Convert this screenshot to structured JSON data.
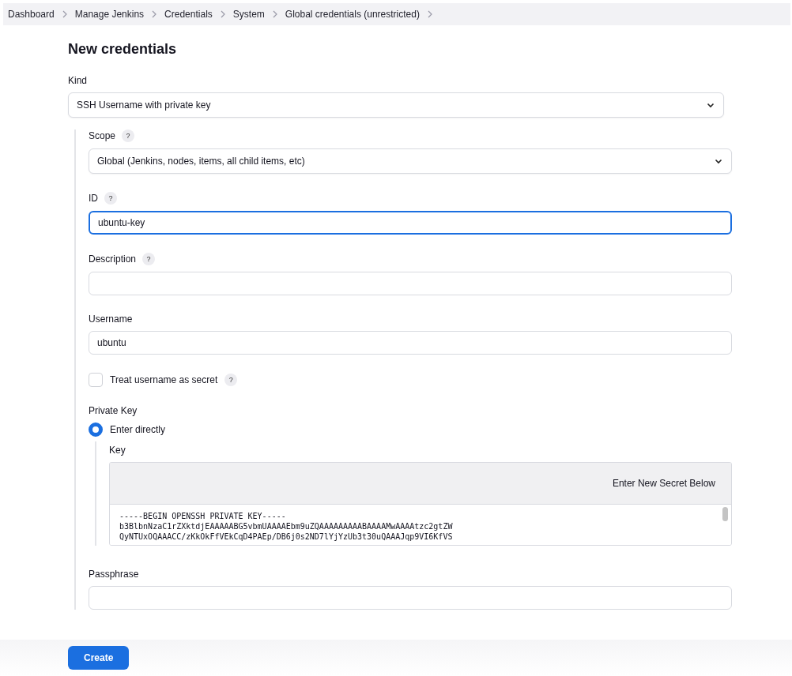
{
  "breadcrumbs": [
    "Dashboard",
    "Manage Jenkins",
    "Credentials",
    "System",
    "Global credentials (unrestricted)"
  ],
  "title": "New credentials",
  "kind": {
    "label": "Kind",
    "value": "SSH Username with private key"
  },
  "fields": [
    {
      "kind": "select",
      "label": "Scope",
      "help": "?",
      "value": "Global (Jenkins, nodes, items, all child items, etc)",
      "focused": false
    },
    {
      "kind": "text",
      "label": "ID",
      "help": "?",
      "value": "ubuntu-key",
      "focused": true
    },
    {
      "kind": "text",
      "label": "Description",
      "help": "?",
      "focused": false
    },
    {
      "kind": "text",
      "label": "Username",
      "value": "ubuntu",
      "focused": false
    },
    {
      "kind": "checkbox",
      "label": "Treat username as secret",
      "help": "?",
      "checked": false
    }
  ],
  "private_key": {
    "label": "Private Key",
    "options": [
      {
        "label": "Enter directly",
        "selected": true
      }
    ],
    "key_label": "Key",
    "secret_hint": "Enter New Secret Below",
    "key_lines": [
      "-----BEGIN OPENSSH PRIVATE KEY-----",
      "b3BlbnNzaC1rZXktdjEAAAAABG5vbmUAAAAEbm9uZQAAAAAAAAABAAAAMwAAAAtzc2gtZW",
      "QyNTUxOQAAACC/zKkOkFfVEkCqD4PAEp/DB6j0s2ND7lYjYzUb3t30uQAAAJqp9VI6KfVS"
    ]
  },
  "passphrase": {
    "label": "Passphrase"
  },
  "submit": "Create"
}
